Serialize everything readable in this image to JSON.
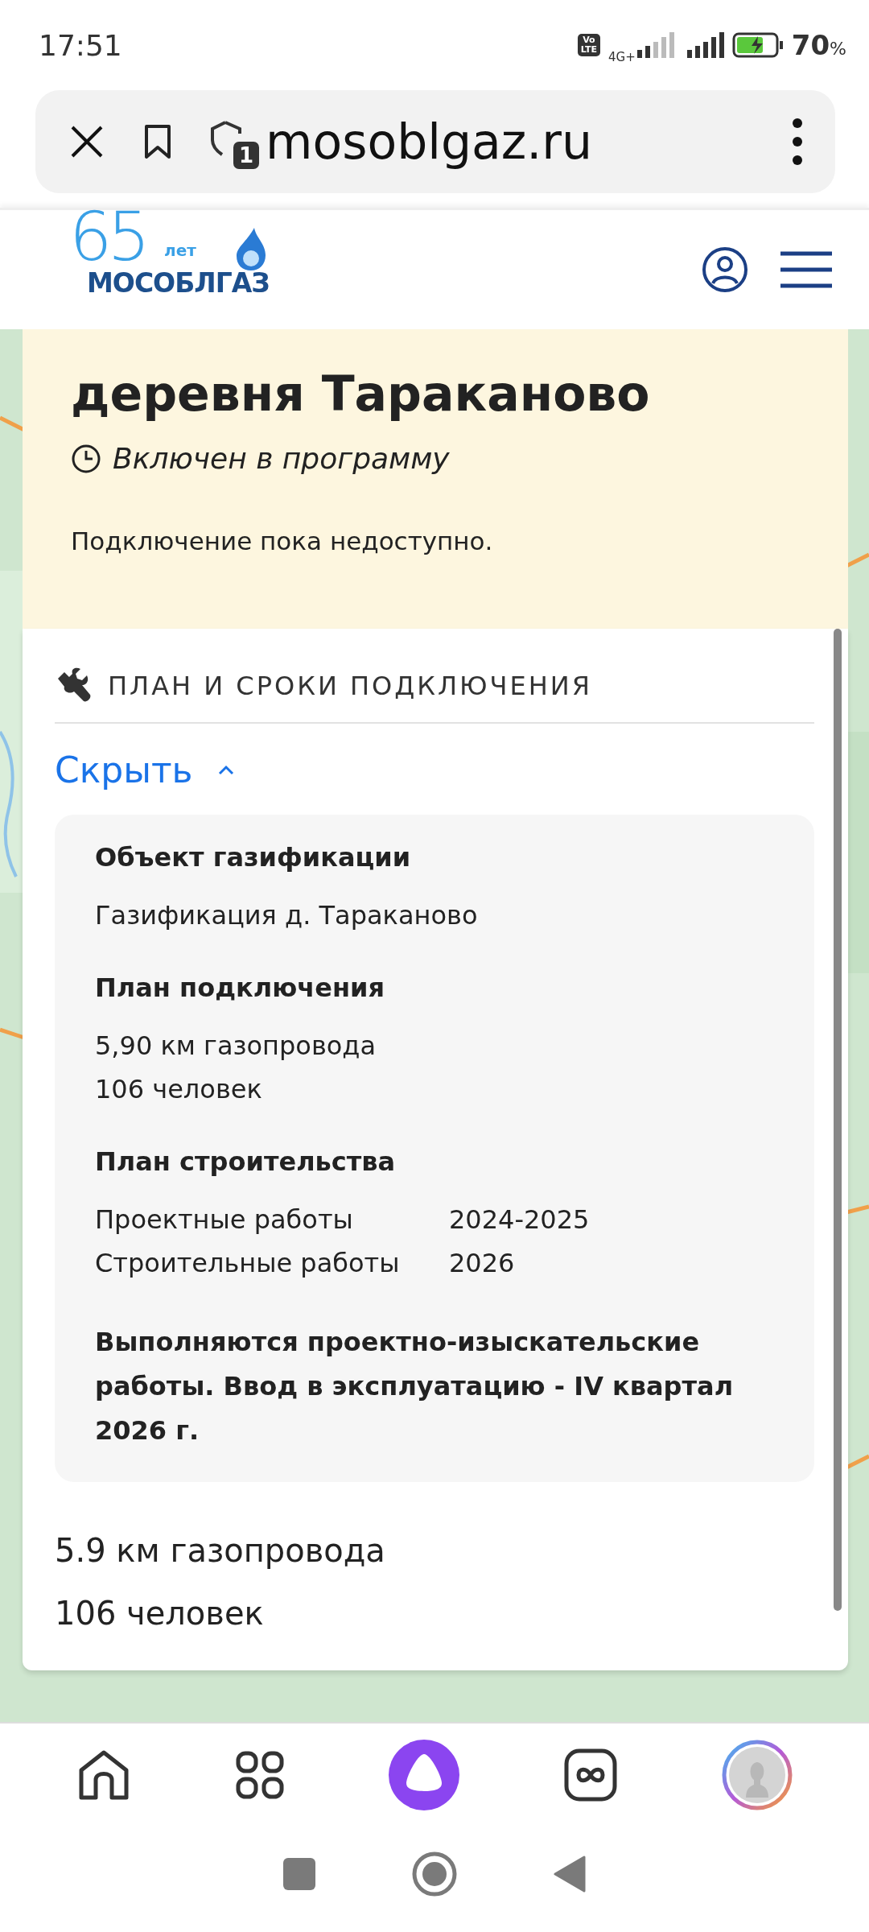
{
  "status_bar": {
    "time": "17:51",
    "volte": [
      "Vo",
      "LTE"
    ],
    "network": "4G+",
    "battery": "70",
    "battery_unit": "%"
  },
  "browser": {
    "url": "mosoblgaz.ru",
    "shield_badge": "1"
  },
  "site_header": {
    "logo_number": "65",
    "logo_years": "лет",
    "logo_name": "МОСОБЛГАЗ"
  },
  "locality": {
    "title": "деревня Тараканово",
    "status": "Включен в программу",
    "note": "Подключение пока недоступно."
  },
  "plan": {
    "section_title": "ПЛАН И СРОКИ ПОДКЛЮЧЕНИЯ",
    "toggle": "Скрыть",
    "expanded": true,
    "details": [
      {
        "kind": "lines",
        "heading": "Объект газификации",
        "lines": [
          "Газификация д. Тараканово"
        ]
      },
      {
        "kind": "lines",
        "heading": "План подключения",
        "lines": [
          "5,90 км газопровода",
          "106 человек"
        ]
      },
      {
        "kind": "table",
        "heading": "План строительства",
        "rows": [
          {
            "label": "Проектные работы",
            "value": "2024-2025"
          },
          {
            "label": "Строительные работы",
            "value": "2026"
          }
        ]
      },
      {
        "kind": "note",
        "text": "Выполняются проектно-изыскательские работы. Ввод в эксплуатацию - IV квартал 2026 г."
      }
    ],
    "summary": [
      "5.9 км газопровода",
      "106 человек"
    ]
  }
}
